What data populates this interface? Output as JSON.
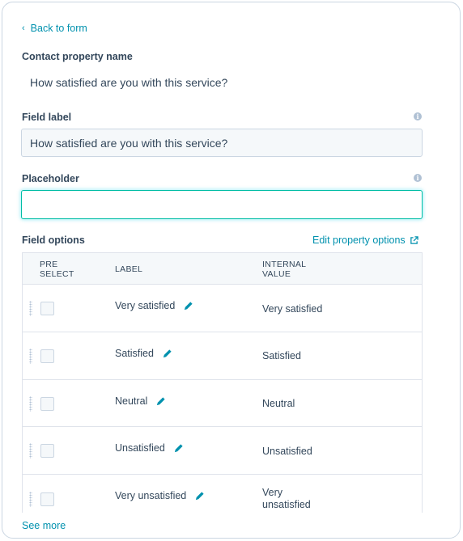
{
  "nav": {
    "back_label": "Back to form"
  },
  "contact_property": {
    "label": "Contact property name",
    "value": "How satisfied are you with this service?"
  },
  "field_label": {
    "label": "Field label",
    "value": "How satisfied are you with this service?"
  },
  "placeholder": {
    "label": "Placeholder",
    "value": ""
  },
  "field_options": {
    "label": "Field options",
    "edit_link": "Edit property options",
    "columns": [
      "PRE SELECT",
      "LABEL",
      "INTERNAL VALUE"
    ],
    "rows": [
      {
        "label": "Very satisfied",
        "value": "Very satisfied",
        "checked": false
      },
      {
        "label": "Satisfied",
        "value": "Satisfied",
        "checked": false
      },
      {
        "label": "Neutral",
        "value": "Neutral",
        "checked": false
      },
      {
        "label": "Unsatisfied",
        "value": "Unsatisfied",
        "checked": false
      },
      {
        "label": "Very unsatisfied",
        "value": "Very unsatisfied",
        "checked": false
      }
    ]
  },
  "footer": {
    "see_more": "See more"
  },
  "colors": {
    "link": "#0091ae",
    "text": "#33475b",
    "border": "#cbd6e2",
    "focus": "#00bda5",
    "pencil": "#0091ae"
  },
  "icons": [
    "chevron-left-icon",
    "info-icon",
    "external-link-icon",
    "drag-handle-icon",
    "pencil-icon"
  ]
}
